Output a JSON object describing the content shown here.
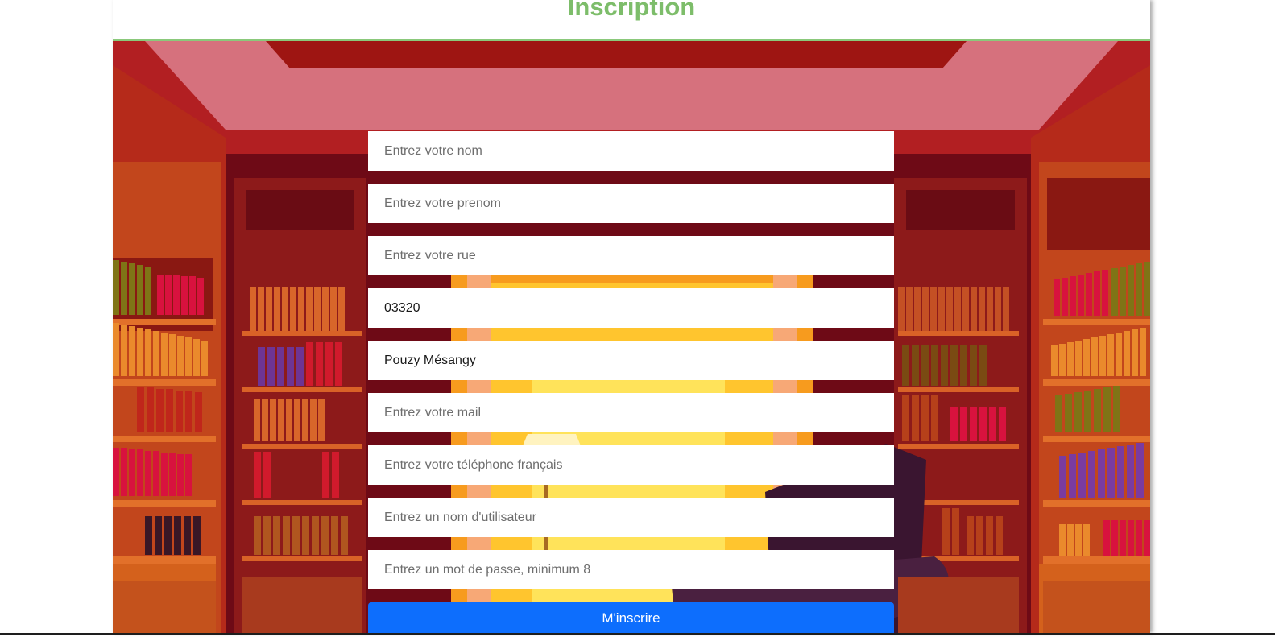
{
  "header": {
    "title": "Inscription"
  },
  "form": {
    "fields": [
      {
        "name": "nom",
        "placeholder": "Entrez votre nom",
        "value": ""
      },
      {
        "name": "prenom",
        "placeholder": "Entrez votre prenom",
        "value": ""
      },
      {
        "name": "rue",
        "placeholder": "Entrez votre rue",
        "value": ""
      },
      {
        "name": "code_postal",
        "placeholder": "",
        "value": "03320"
      },
      {
        "name": "ville",
        "placeholder": "",
        "value": "Pouzy Mésangy"
      },
      {
        "name": "mail",
        "placeholder": "Entrez votre mail",
        "value": ""
      },
      {
        "name": "telephone",
        "placeholder": "Entrez votre téléphone français",
        "value": ""
      },
      {
        "name": "utilisateur",
        "placeholder": "Entrez un nom d'utilisateur",
        "value": ""
      },
      {
        "name": "mot_de_passe",
        "placeholder": "Entrez un mot de passe, minimum 8",
        "value": ""
      }
    ],
    "submit_label": "M'inscrire"
  },
  "colors": {
    "title": "#7dbd6a",
    "header_border": "#8ac97b",
    "submit_bg": "#0d6efd"
  }
}
